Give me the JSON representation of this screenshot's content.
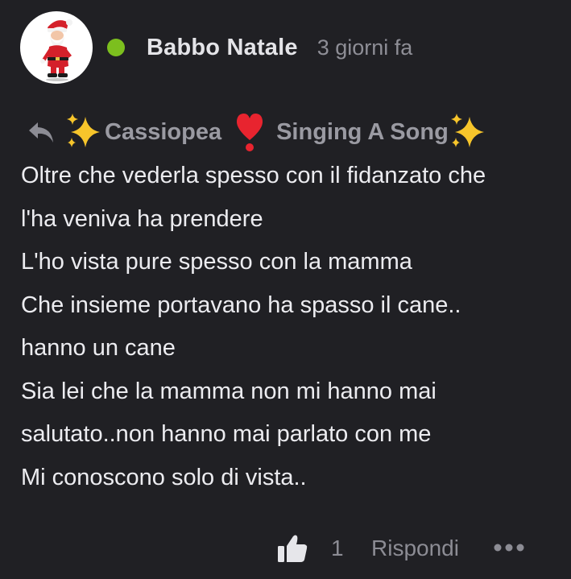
{
  "comment": {
    "author": "Babbo Natale",
    "avatar_icon": "santa-claus-avatar",
    "online_status_color": "#7cbf1e",
    "timestamp": "3 giorni fa",
    "reply_to": {
      "icon": "reply-arrow-icon",
      "prefix_emoji": "sparkles",
      "name": "Cassiopea",
      "separator_emoji": "heavy-exclamation-heart",
      "suffix_text": "Singing A Song",
      "suffix_emoji": "sparkles"
    },
    "body_lines": [
      "Oltre che vederla spesso con il fidanzato che",
      "l'ha veniva ha prendere",
      "L'ho vista pure spesso con la mamma",
      "Che insieme portavano ha spasso il cane..",
      "hanno un cane",
      "Sia lei che la mamma non mi hanno mai",
      "salutato..non hanno mai parlato con me",
      "Mi conoscono solo di vista.."
    ]
  },
  "actions": {
    "like_icon": "thumbs-up-icon",
    "like_count": "1",
    "reply_label": "Rispondi",
    "more_icon": "more-dots-icon"
  },
  "colors": {
    "background": "#202024",
    "text_primary": "#ececf0",
    "text_muted": "#8e8e96",
    "online": "#7cbf1e",
    "heart": "#e8242f",
    "sparkle": "#f7c52b"
  }
}
